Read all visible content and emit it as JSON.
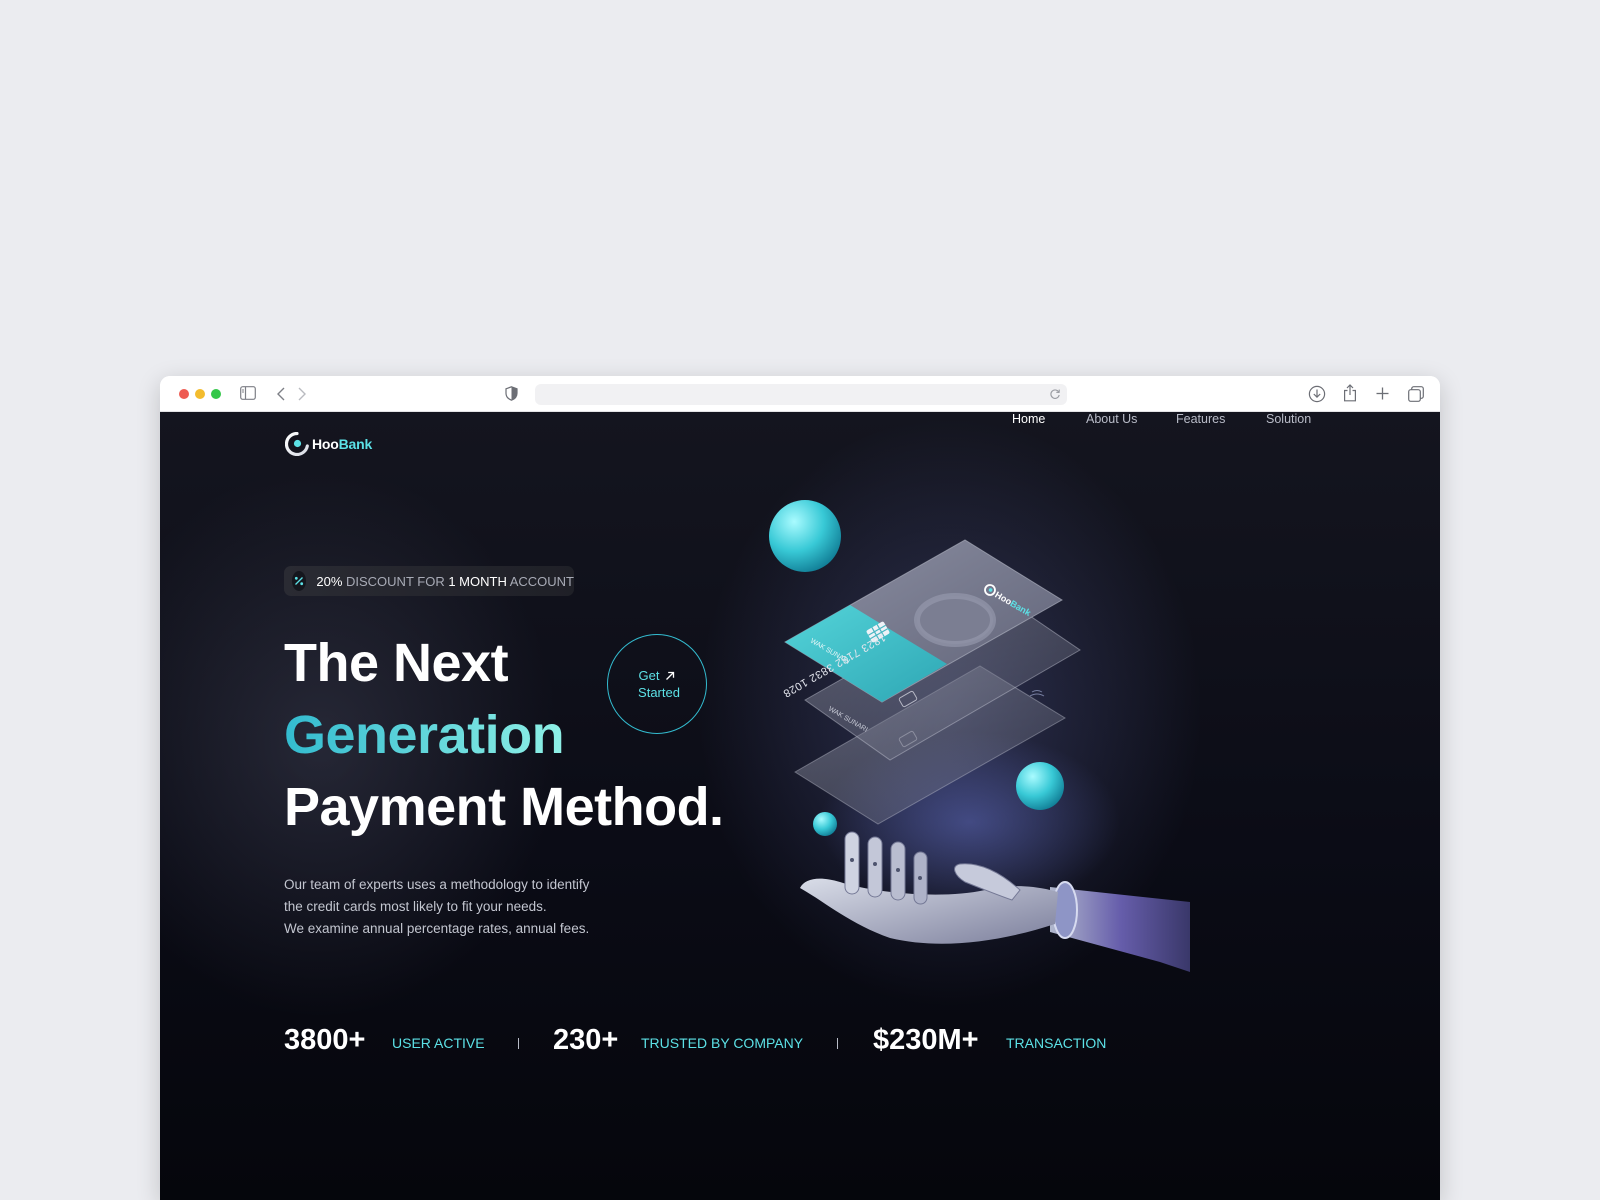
{
  "browser": {
    "address": ""
  },
  "brand": {
    "name_part1": "Hoo",
    "name_part2": "Bank"
  },
  "nav": {
    "items": [
      {
        "label": "Home",
        "active": true
      },
      {
        "label": "About Us",
        "active": false
      },
      {
        "label": "Features",
        "active": false
      },
      {
        "label": "Solution",
        "active": false
      }
    ]
  },
  "hero": {
    "badge": {
      "percent": "20%",
      "text_a": " DISCOUNT FOR ",
      "months": "1 MONTH",
      "text_b": " ACCOUNT"
    },
    "headline": {
      "line1": "The Next",
      "line2": "Generation",
      "line3": "Payment Method."
    },
    "cta": {
      "line1": "Get",
      "line2": "Started"
    },
    "description": [
      "Our team of experts uses a methodology to identify",
      "the credit cards most likely to fit your needs.",
      "We examine annual percentage rates, annual fees."
    ]
  },
  "cards": {
    "number": "1823 7182 3832 1028",
    "holder": "WAK SUNARI",
    "brand_part1": "Hoo",
    "brand_part2": "Bank"
  },
  "stats": [
    {
      "value": "3800+",
      "label": "USER ACTIVE"
    },
    {
      "value": "230+",
      "label": "TRUSTED BY COMPANY"
    },
    {
      "value": "$230M+",
      "label": "TRANSACTION"
    }
  ],
  "colors": {
    "accent": "#5ce1e6",
    "accent_dark": "#33bbcf",
    "background": "#0b0c16",
    "desktop": "#ebecf0"
  }
}
